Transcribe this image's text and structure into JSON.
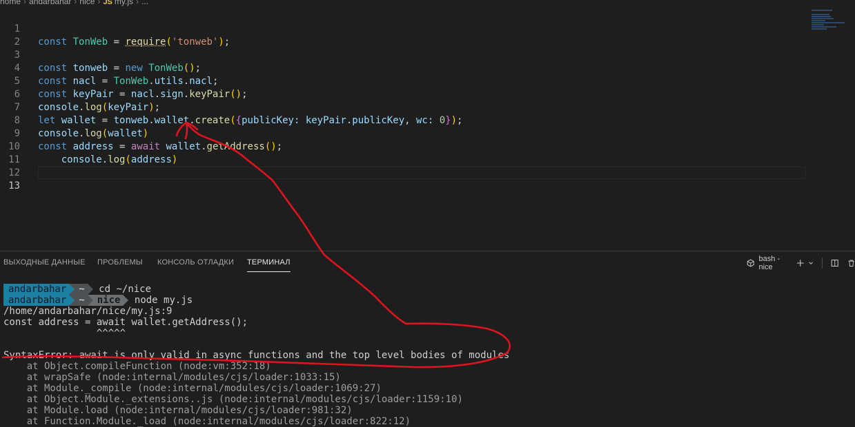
{
  "breadcrumb": {
    "parts": [
      "home",
      "andarbahar",
      "nice"
    ],
    "file_icon": "JS",
    "file": "my.js",
    "tail": "..."
  },
  "editor": {
    "line_numbers": [
      "1",
      "2",
      "3",
      "4",
      "5",
      "6",
      "7",
      "8",
      "9",
      "10",
      "11",
      "12",
      "13"
    ],
    "active_line": "13",
    "code": {
      "l1": {
        "kw": "const",
        "var": "TonWeb",
        "op": " = ",
        "fn": "require",
        "open": "(",
        "str": "'tonweb'",
        "close": ")",
        "end": ";"
      },
      "l3": {
        "kw": "const",
        "var": "tonweb",
        "op": " = ",
        "kw2": "new",
        "cls": "TonWeb",
        "parens": "()",
        "end": ";"
      },
      "l4": {
        "kw": "const",
        "var": "nacl",
        "op": " = ",
        "a": "TonWeb",
        "b": "utils",
        "c": "nacl",
        "end": ";"
      },
      "l5": {
        "kw": "const",
        "var": "keyPair",
        "op": " = ",
        "a": "nacl",
        "b": "sign",
        "fn": "keyPair",
        "parens": "()",
        "end": ";"
      },
      "l6": {
        "a": "console",
        "fn": "log",
        "open": "(",
        "arg": "keyPair",
        "close": ")",
        "end": ";"
      },
      "l7": {
        "kw": "let",
        "var": "wallet",
        "op": " = ",
        "a": "tonweb",
        "b": "wallet",
        "fn": "create",
        "open": "(",
        "obr": "{",
        "k1": "publicKey",
        "colon1": ": ",
        "v1a": "keyPair",
        "v1b": "publicKey",
        "comma": ", ",
        "k2": "wc",
        "colon2": ": ",
        "num": "0",
        "cbr": "}",
        "close": ")",
        "end": ";"
      },
      "l8": {
        "a": "console",
        "fn": "log",
        "open": "(",
        "arg": "wallet",
        "close": ")"
      },
      "l9": {
        "kw": "const",
        "var": "address",
        "op": " = ",
        "kw2": "await",
        "a": "wallet",
        "fn": "getAddress",
        "parens": "()",
        "end": ";"
      },
      "l10": {
        "indent": "    ",
        "a": "console",
        "fn": "log",
        "open": "(",
        "arg": "address",
        "close": ")"
      }
    }
  },
  "panel": {
    "tabs": [
      "ВЫХОДНЫЕ ДАННЫЕ",
      "ПРОБЛЕМЫ",
      "КОНСОЛЬ ОТЛАДКИ",
      "ТЕРМИНАЛ"
    ],
    "active_tab": "ТЕРМИНАЛ",
    "terminal_name": "bash - nice",
    "icons": [
      "terminal-icon",
      "plus-icon",
      "chevron-down-icon",
      "split-icon",
      "trash-icon"
    ]
  },
  "terminal": {
    "prompt1": {
      "user": "andarbahar",
      "dir": "~",
      "cmd": "cd ~/nice"
    },
    "prompt2": {
      "user": "andarbahar",
      "dir": "~",
      "dir2": "nice",
      "cmd": "node my.js"
    },
    "output": [
      "/home/andarbahar/nice/my.js:9",
      "const address = await wallet.getAddress();",
      "                ^^^^^",
      "",
      "SyntaxError: await is only valid in async functions and the top level bodies of modules"
    ],
    "stack": [
      "    at Object.compileFunction (node:vm:352:18)",
      "    at wrapSafe (node:internal/modules/cjs/loader:1033:15)",
      "    at Module._compile (node:internal/modules/cjs/loader:1069:27)",
      "    at Object.Module._extensions..js (node:internal/modules/cjs/loader:1159:10)",
      "    at Module.load (node:internal/modules/cjs/loader:981:32)",
      "    at Function.Module._load (node:internal/modules/cjs/loader:822:12)"
    ]
  },
  "colors": {
    "annotation": "#e0141e",
    "prompt_user_bg": "#1c7fa4",
    "editor_bg": "#1e1e1e"
  }
}
